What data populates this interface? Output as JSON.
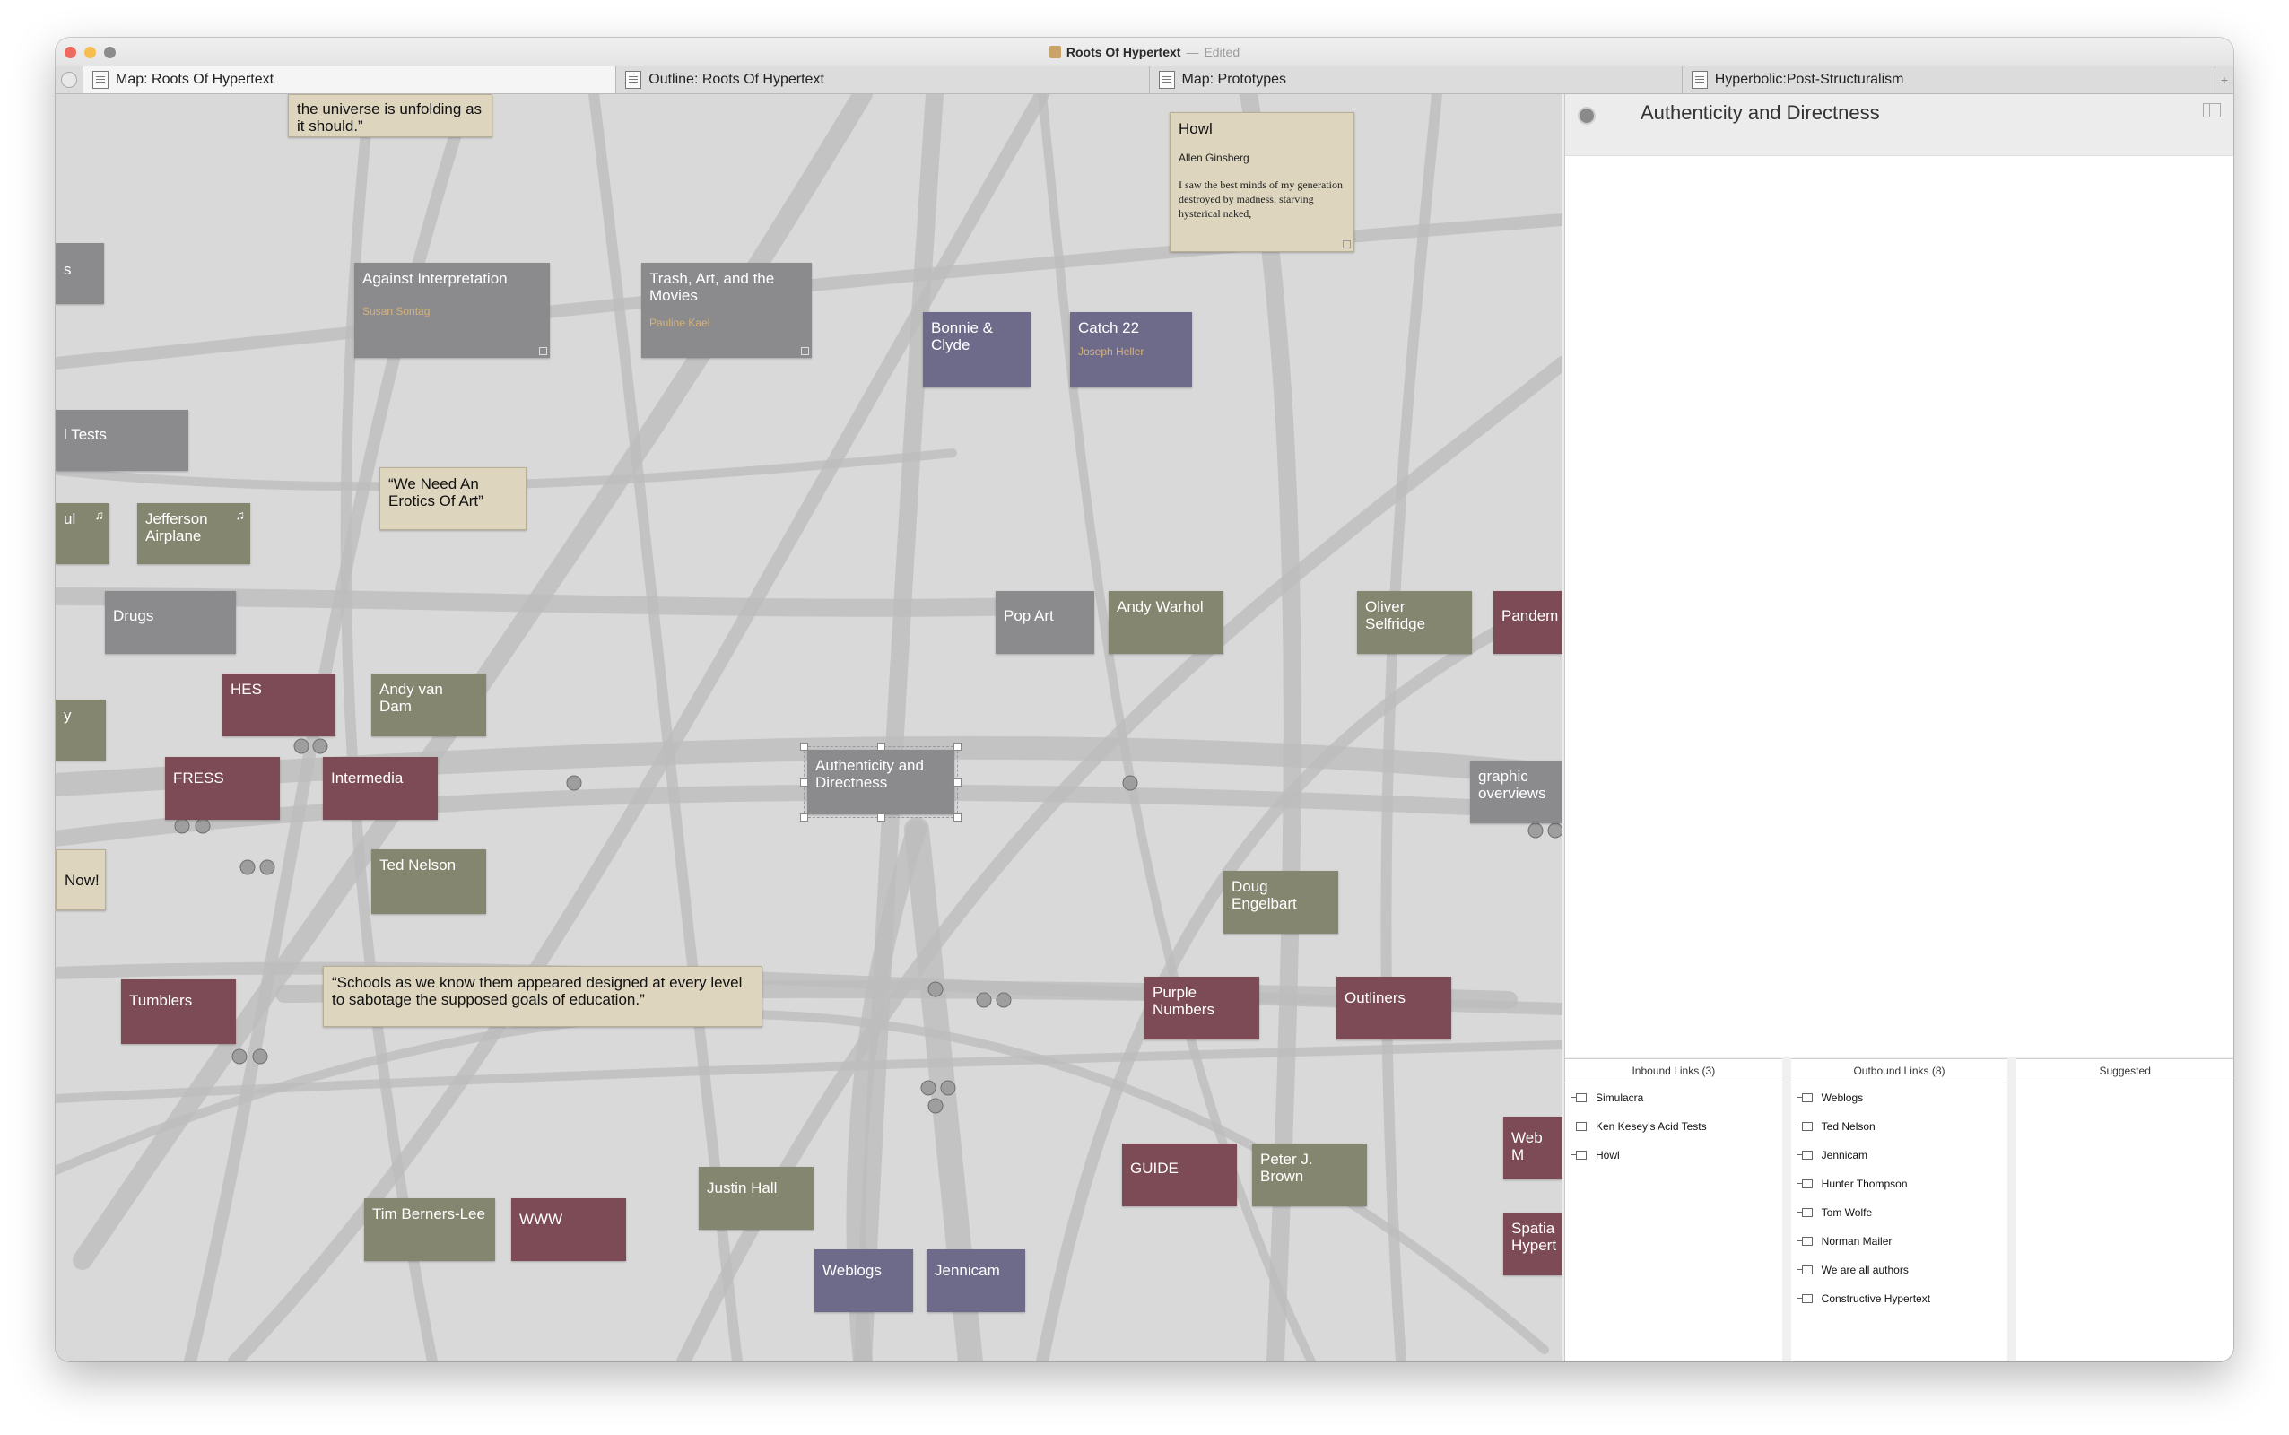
{
  "window": {
    "title": "Roots Of Hypertext",
    "title_sep": "—",
    "edited": "Edited"
  },
  "tabs": [
    {
      "label": "Map: Roots Of Hypertext"
    },
    {
      "label": "Outline: Roots Of Hypertext"
    },
    {
      "label": "Map: Prototypes"
    },
    {
      "label": "Hyperbolic:Post-Structuralism"
    }
  ],
  "tab_plus": "+",
  "notes": {
    "universe": "the universe is unfolding as it should.”",
    "howl_title": "Howl",
    "howl_author": "Allen Ginsberg",
    "howl_body": "I saw the best minds of my generation destroyed by madness, starving hysterical naked,",
    "s_left": "s",
    "against": "Against Interpretation",
    "against_author": "Susan Sontag",
    "trash": "Trash, Art, and the Movies",
    "trash_author": "Pauline Kael",
    "bonnie": "Bonnie & Clyde",
    "catch22": "Catch 22",
    "catch22_author": "Joseph Heller",
    "tests": "l Tests",
    "erotics": "“We Need An Erotics Of Art”",
    "ul": "ul",
    "jefferson": "Jefferson Airplane",
    "drugs": "Drugs",
    "popart": "Pop Art",
    "warhol": "Andy Warhol",
    "selfridge": "Oliver Selfridge",
    "pandem": "Pandem",
    "hes": "HES",
    "vandam": "Andy van Dam",
    "y": "y",
    "fress": "FRESS",
    "intermedia": "Intermedia",
    "authenticity": "Authenticity and Directness",
    "graphic": "graphic overviews",
    "now": "Now!",
    "nelson": "Ted Nelson",
    "engelbart": "Doug Engelbart",
    "schools": "“Schools as we know them appeared designed at every level to sabotage the supposed goals of education.”",
    "tumblers": "Tumblers",
    "purple": "Purple Numbers",
    "outliners": "Outliners",
    "webm": "Web M",
    "guide": "GUIDE",
    "brown": "Peter J. Brown",
    "justin": "Justin Hall",
    "berners": "Tim Berners-Lee",
    "www": "WWW",
    "spatial": "Spatia Hypert",
    "weblogs": "Weblogs",
    "jennicam": "Jennicam",
    "music_glyph": "♫"
  },
  "panel": {
    "title": "Authenticity and Directness",
    "inbound_head": "Inbound Links (3)",
    "outbound_head": "Outbound Links (8)",
    "suggested_head": "Suggested",
    "inbound": [
      "Simulacra",
      "Ken Kesey’s Acid Tests",
      "Howl"
    ],
    "outbound": [
      "Weblogs",
      "Ted Nelson",
      "Jennicam",
      "Hunter Thompson",
      "Tom Wolfe",
      "Norman Mailer",
      "We are all authors",
      "Constructive Hypertext"
    ]
  },
  "colors": {
    "map_bg": "#d9d9d9",
    "gray": "#8b8b8d",
    "olive": "#84866f",
    "maroon": "#7d4b55",
    "slate": "#6d6a8a",
    "tan": "#ded5bf"
  }
}
